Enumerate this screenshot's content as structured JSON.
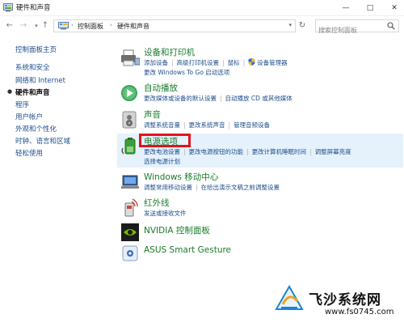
{
  "window": {
    "title": "硬件和声音",
    "minimize": "—",
    "maximize": "□",
    "close": "✕"
  },
  "address": {
    "crumbs": [
      "控制面板",
      "硬件和声音"
    ],
    "search_placeholder": "搜索控制面板"
  },
  "sidebar": {
    "items": [
      {
        "label": "控制面板主页"
      },
      {
        "label": "系统和安全"
      },
      {
        "label": "网络和 Internet"
      },
      {
        "label": "硬件和声音",
        "current": true
      },
      {
        "label": "程序"
      },
      {
        "label": "用户帐户"
      },
      {
        "label": "外观和个性化"
      },
      {
        "label": "时钟、语言和区域"
      },
      {
        "label": "轻松使用"
      }
    ]
  },
  "categories": [
    {
      "title": "设备和打印机",
      "icon": "printer-icon",
      "rows": [
        [
          "添加设备",
          "高级打印机设置",
          "鼠标",
          "设备管理器"
        ],
        [
          "更改 Windows To Go 启动选项"
        ]
      ]
    },
    {
      "title": "自动播放",
      "icon": "autoplay-icon",
      "rows": [
        [
          "更改媒体或设备的默认设置",
          "自动播放 CD 或其他媒体"
        ]
      ]
    },
    {
      "title": "声音",
      "icon": "speaker-icon",
      "rows": [
        [
          "调整系统音量",
          "更改系统声音",
          "管理音频设备"
        ]
      ]
    },
    {
      "title": "电源选项",
      "icon": "power-options-icon",
      "rows": [
        [
          "更改电池设置",
          "更改电源按钮的功能",
          "更改计算机睡眠时间",
          "调整屏幕亮度"
        ],
        [
          "选择电源计划"
        ]
      ]
    },
    {
      "title": "Windows 移动中心",
      "icon": "mobility-center-icon",
      "rows": [
        [
          "调整常用移动设置",
          "在给出演示文稿之前调整设置"
        ]
      ]
    },
    {
      "title": "红外线",
      "icon": "infrared-icon",
      "rows": [
        [
          "发送或接收文件"
        ]
      ]
    },
    {
      "title": "NVIDIA 控制面板",
      "icon": "nvidia-icon",
      "rows": []
    },
    {
      "title": "ASUS Smart Gesture",
      "icon": "touchpad-icon",
      "rows": []
    }
  ],
  "watermark": {
    "title": "飞沙系统网",
    "url": "www.fs0745.com"
  },
  "colors": {
    "category_title": "#1a7b2c",
    "link": "#1e4e8c",
    "highlight_bg": "#e5f1fb",
    "annotation_box": "#e0141e"
  }
}
